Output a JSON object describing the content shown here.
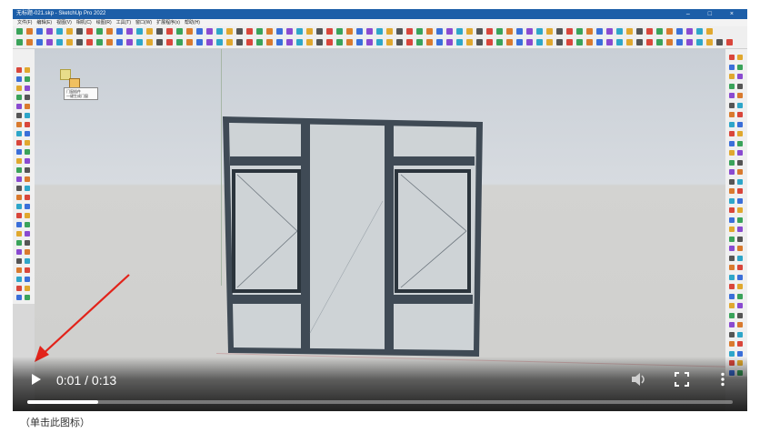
{
  "app": {
    "window_title": "无标题-021.skp - SketchUp Pro 2022",
    "window_controls": "– □ ×",
    "menu_items": [
      "文件(F)",
      "编辑(E)",
      "视图(V)",
      "相机(C)",
      "绘图(R)",
      "工具(T)",
      "窗口(W)",
      "扩展程序(x)",
      "帮助(H)"
    ]
  },
  "tooltip": {
    "line1": "门窗插件",
    "line2": "一键生成门窗"
  },
  "player": {
    "current_time": "0:01",
    "duration": "0:13",
    "time_display": "0:01 / 0:13",
    "progress_fraction": 0.1,
    "play_icon": "play-icon",
    "volume_icon": "volume-icon",
    "fullscreen_icon": "fullscreen-icon",
    "more_icon": "more-options-icon"
  },
  "annotation": {
    "arrow_color": "#e2231a"
  },
  "footer": {
    "caption": "（单击此图标）"
  },
  "colors": {
    "frame": "#3f4a55",
    "glass": "#ced3d6",
    "accent_blue": "#1c5ea8"
  }
}
